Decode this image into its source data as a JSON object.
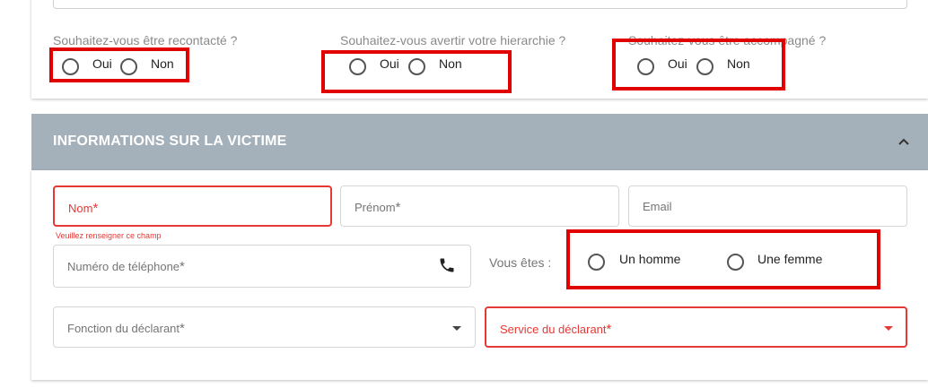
{
  "contact_questions": [
    {
      "label": "Souhaitez-vous être recontacté ?",
      "options": [
        "Oui",
        "Non"
      ]
    },
    {
      "label": "Souhaitez-vous avertir votre hierarchie ?",
      "options": [
        "Oui",
        "Non"
      ]
    },
    {
      "label": "Souhaitez-vous être accompagné ?",
      "options": [
        "Oui",
        "Non"
      ]
    }
  ],
  "section": {
    "title": "INFORMATIONS SUR LA VICTIME",
    "collapse_icon": "chevron-up-icon"
  },
  "fields": {
    "nom": {
      "label": "Nom",
      "required_mark": "*",
      "error": "Veuillez renseigner ce champ"
    },
    "prenom": {
      "label": "Prénom",
      "required_mark": "*"
    },
    "email": {
      "label": "Email"
    },
    "phone": {
      "label": "Numéro de téléphone",
      "required_mark": "*",
      "icon": "phone-icon"
    },
    "gender": {
      "label": "Vous êtes :",
      "options": [
        "Un homme",
        "Une femme"
      ]
    },
    "fonction": {
      "label": "Fonction du déclarant",
      "required_mark": "*"
    },
    "service": {
      "label": "Service du déclarant",
      "required_mark": "*"
    }
  },
  "colors": {
    "header_bg": "#a4b0ba",
    "error": "#e53935",
    "highlight": "#e00000"
  }
}
